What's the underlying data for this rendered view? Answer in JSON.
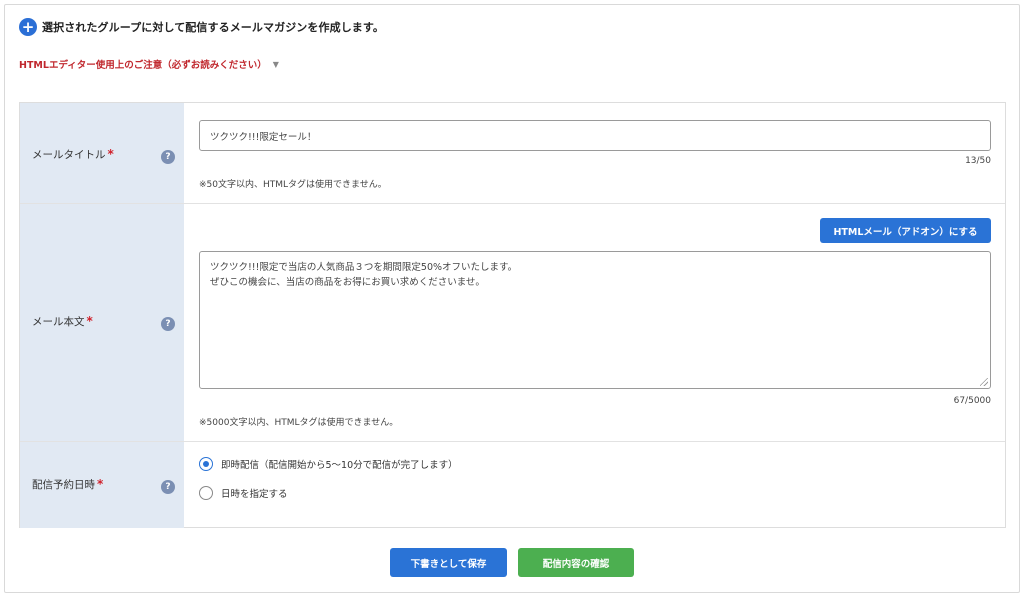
{
  "header": {
    "text": "選択されたグループに対して配信するメールマガジンを作成します。"
  },
  "notice": {
    "text": "HTMLエディター使用上のご注意（必ずお読みください）",
    "caret": "▼"
  },
  "form": {
    "title_row": {
      "label": "メールタイトル",
      "required": "*",
      "help": "?",
      "value": "ツクツク!!!限定セール！",
      "counter": "13/50",
      "hint": "※50文字以内、HTMLタグは使用できません。"
    },
    "body_row": {
      "label": "メール本文",
      "required": "*",
      "help": "?",
      "html_button": "HTMLメール（アドオン）にする",
      "line1": "ツクツク!!!限定で当店の人気商品３つを期間限定50%オフいたします。",
      "line2": "ぜひこの機会に、当店の商品をお得にお買い求めくださいませ。",
      "counter": "67/5000",
      "hint": "※5000文字以内、HTMLタグは使用できません。"
    },
    "schedule_row": {
      "label": "配信予約日時",
      "required": "*",
      "help": "?",
      "options": [
        {
          "label": "即時配信（配信開始から5〜10分で配信が完了します）",
          "checked": true
        },
        {
          "label": "日時を指定する",
          "checked": false
        }
      ]
    }
  },
  "actions": {
    "save_label": "下書きとして保存",
    "confirm_label": "配信内容の確認"
  },
  "colors": {
    "primary": "#2a73d6",
    "confirm": "#4caf50",
    "label_bg": "#e1e9f3",
    "notice": "#c0272d",
    "required": "#d0202a"
  }
}
